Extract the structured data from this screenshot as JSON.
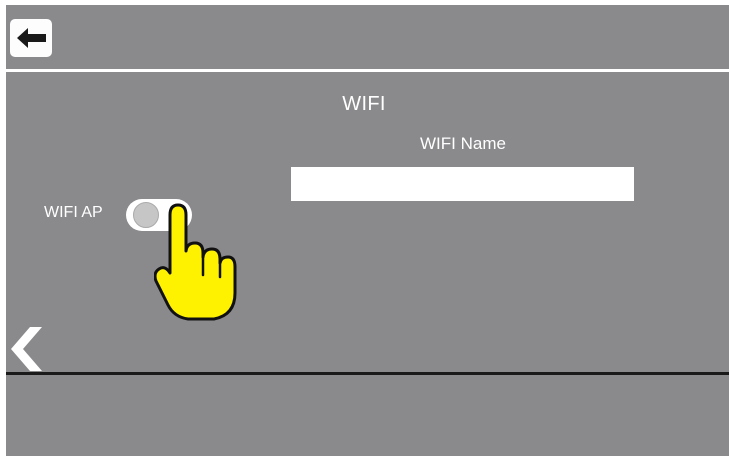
{
  "header": {
    "back_icon": "arrow-left-icon"
  },
  "page": {
    "title": "WIFI"
  },
  "wifi_name": {
    "label": "WIFI Name",
    "value": ""
  },
  "wifi_ap": {
    "label": "WIFI AP",
    "state": "off"
  },
  "navigation": {
    "prev_icon": "chevron-left-icon"
  },
  "overlay": {
    "icon": "pointing-hand-icon"
  },
  "colors": {
    "background": "#8a8a8c",
    "hand": "#fff200",
    "divider_top": "#ffffff",
    "divider_bottom": "#1a1a1a"
  }
}
